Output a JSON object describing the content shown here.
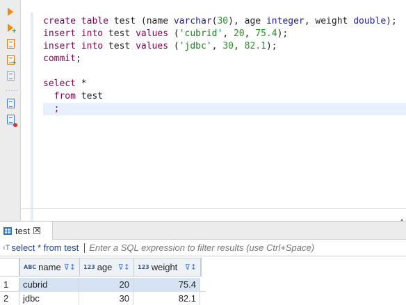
{
  "toolbar": {
    "buttons": [
      {
        "name": "execute-statement",
        "icon": "play-icon"
      },
      {
        "name": "execute-in-new-tab",
        "icon": "play-plus-icon"
      },
      {
        "name": "execute-script",
        "icon": "script-icon"
      },
      {
        "name": "execute-script-new-tab",
        "icon": "script-plus-icon"
      },
      {
        "name": "explain-plan",
        "icon": "plan-icon"
      },
      {
        "name": "load-script",
        "icon": "load-icon"
      },
      {
        "name": "save-script",
        "icon": "save-icon"
      }
    ],
    "separator": "....."
  },
  "editor": {
    "lines": [
      [
        {
          "t": "create table ",
          "c": "kw"
        },
        {
          "t": "test ",
          "c": "id"
        },
        {
          "t": "(name ",
          "c": "id"
        },
        {
          "t": "varchar",
          "c": "tp"
        },
        {
          "t": "(",
          "c": "id"
        },
        {
          "t": "30",
          "c": "nm"
        },
        {
          "t": "), age ",
          "c": "id"
        },
        {
          "t": "integer",
          "c": "tp"
        },
        {
          "t": ", weight ",
          "c": "id"
        },
        {
          "t": "double",
          "c": "tp"
        },
        {
          "t": ");",
          "c": "id"
        }
      ],
      [
        {
          "t": "insert into ",
          "c": "kw"
        },
        {
          "t": "test ",
          "c": "id"
        },
        {
          "t": "values ",
          "c": "kw"
        },
        {
          "t": "(",
          "c": "id"
        },
        {
          "t": "'cubrid'",
          "c": "st"
        },
        {
          "t": ", ",
          "c": "id"
        },
        {
          "t": "20",
          "c": "nm"
        },
        {
          "t": ", ",
          "c": "id"
        },
        {
          "t": "75.4",
          "c": "nm"
        },
        {
          "t": ");",
          "c": "id"
        }
      ],
      [
        {
          "t": "insert into ",
          "c": "kw"
        },
        {
          "t": "test ",
          "c": "id"
        },
        {
          "t": "values ",
          "c": "kw"
        },
        {
          "t": "(",
          "c": "id"
        },
        {
          "t": "'jdbc'",
          "c": "st"
        },
        {
          "t": ", ",
          "c": "id"
        },
        {
          "t": "30",
          "c": "nm"
        },
        {
          "t": ", ",
          "c": "id"
        },
        {
          "t": "82.1",
          "c": "nm"
        },
        {
          "t": ");",
          "c": "id"
        }
      ],
      [
        {
          "t": "commit",
          "c": "kw"
        },
        {
          "t": ";",
          "c": "id"
        }
      ],
      [],
      [
        {
          "t": "select ",
          "c": "kw"
        },
        {
          "t": "*",
          "c": "id"
        }
      ],
      [
        {
          "t": "  ",
          "c": "id"
        },
        {
          "t": "from ",
          "c": "kw"
        },
        {
          "t": "test",
          "c": "id"
        }
      ],
      [
        {
          "t": "  ",
          "c": "id"
        },
        {
          "t": ";",
          "c": "kw"
        }
      ]
    ],
    "current_line": 7
  },
  "results": {
    "tab": {
      "label": "test",
      "close": "✕"
    },
    "filter": {
      "query": "select * from test",
      "placeholder": "Enter a SQL expression to filter results (use Ctrl+Space)"
    },
    "columns": [
      {
        "type": "ABC",
        "name": "name",
        "align": "l",
        "width": 86
      },
      {
        "type": "123",
        "name": "age",
        "align": "r",
        "width": 78
      },
      {
        "type": "123",
        "name": "weight",
        "align": "r",
        "width": 96
      }
    ],
    "rows": [
      {
        "num": "1",
        "cells": [
          "cubrid",
          "20",
          "75.4"
        ],
        "selected": true
      },
      {
        "num": "2",
        "cells": [
          "jdbc",
          "30",
          "82.1"
        ],
        "selected": false
      }
    ]
  }
}
